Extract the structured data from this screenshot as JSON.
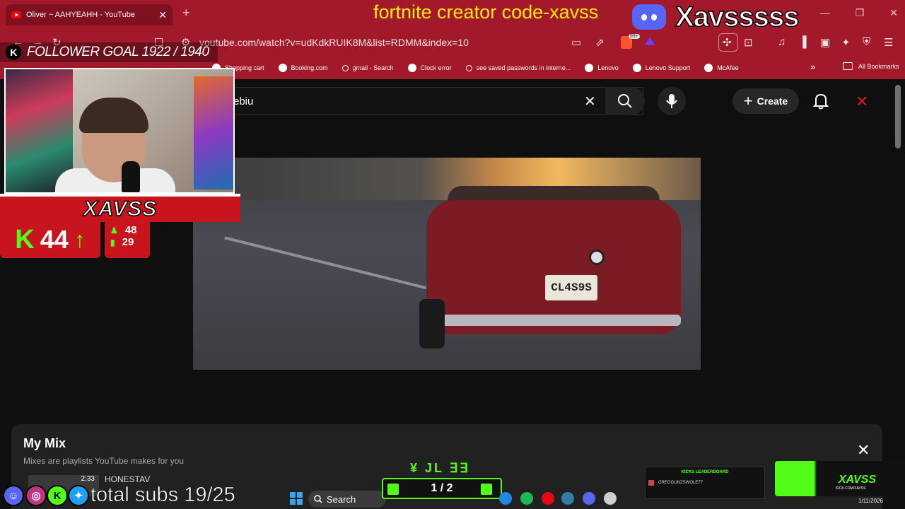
{
  "browser": {
    "tab_title": "Oliver ~ AAHYEAHH - YouTube",
    "url": "youtube.com/watch?v=udKdkRUIK8M&list=RDMM&index=10",
    "badge_count": "99+",
    "bookmarks": [
      {
        "label": "Shopping cart",
        "icon": "cart-icon"
      },
      {
        "label": "Booking.com",
        "icon": "globe-icon"
      },
      {
        "label": "gmail - Search",
        "icon": "search-icon"
      },
      {
        "label": "Clock error",
        "icon": "globe-icon"
      },
      {
        "label": "see saved passwords in interne...",
        "icon": "search-icon"
      },
      {
        "label": "Lenovo",
        "icon": "globe-icon"
      },
      {
        "label": "Lenovo Support",
        "icon": "globe-icon"
      },
      {
        "label": "McAfee",
        "icon": "globe-icon"
      }
    ],
    "all_bookmarks": "All Bookmarks"
  },
  "youtube": {
    "search_value": "ebiu",
    "create_label": "Create",
    "video": {
      "plate_text": "CL4S9S"
    }
  },
  "mix": {
    "title": "My Mix",
    "subtitle": "Mixes are playlists YouTube makes for you",
    "first_duration": "2:33",
    "first_artist": "HONESTAV"
  },
  "overlay": {
    "creator_code": "fortnite creator code-xavss",
    "discord_name": "Xavsssss",
    "follower_goal": "FOLLOWER GOAL 1922 / 1940",
    "streamer_name": "XAVSS",
    "kick_count": "44",
    "stat_1": "48",
    "stat_2": "29",
    "total_subs": "total subs 19/25",
    "counter": "1 / 2",
    "leaderboard_title": "KICKS LEADERBOARD",
    "leaderboard_user": "GREGGUNZSWOLE77",
    "brand_name": "XAVSS",
    "brand_url": "KICK.COM/XAVSS"
  },
  "taskbar": {
    "search_label": "Search",
    "date": "1/11/2026"
  },
  "colors": {
    "browser_red": "#a3192c",
    "kick_green": "#53fc18",
    "creator_code_yellow": "#ffea00"
  }
}
